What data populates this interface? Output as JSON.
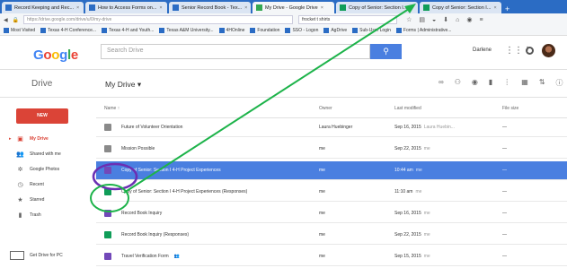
{
  "browser": {
    "tabs": [
      {
        "label": "Record Keeping and Rec...",
        "fav": "#2b6cc4",
        "active": false
      },
      {
        "label": "How to Access Forms on...",
        "fav": "#2b6cc4",
        "active": false
      },
      {
        "label": "Senior Record Book - Tex...",
        "fav": "#2b6cc4",
        "active": false
      },
      {
        "label": "My Drive - Google Drive",
        "fav": "#34a853",
        "active": true
      },
      {
        "label": "Copy of Senior: Section I...",
        "fav": "#0f9d58",
        "active": false
      },
      {
        "label": "Copy of Senior: Section I...",
        "fav": "#0f9d58",
        "active": false
      }
    ],
    "url": "https://drive.google.com/drive/u/0/my-drive",
    "search": "frocket t shirts",
    "bookmarks": [
      "Most Visited",
      "Texas 4-H Conference...",
      "Texas 4-H and Youth...",
      "Texas A&M University...",
      "4HOnline",
      "Foundation",
      "SSO - Logon",
      "AgDrive",
      "Sub-User Login",
      "Forms | Administrative..."
    ]
  },
  "header": {
    "logo": [
      "G",
      "o",
      "o",
      "g",
      "l",
      "e"
    ],
    "search_placeholder": "Search Drive",
    "search_button_icon": "search-icon",
    "user_name": "Darlene"
  },
  "toolbar": {
    "drive_label": "Drive",
    "location": "My Drive ▾",
    "icons": [
      "link-icon",
      "share-icon",
      "preview-icon",
      "delete-icon",
      "more-icon",
      "grid-view-icon",
      "sort-icon",
      "info-icon",
      "settings-icon"
    ]
  },
  "sidebar": {
    "new_label": "NEW",
    "items": [
      {
        "label": "My Drive",
        "icon": "▣",
        "active": true
      },
      {
        "label": "Shared with me",
        "icon": "👥",
        "active": false
      },
      {
        "label": "Google Photos",
        "icon": "✲",
        "active": false
      },
      {
        "label": "Recent",
        "icon": "◷",
        "active": false
      },
      {
        "label": "Starred",
        "icon": "★",
        "active": false
      },
      {
        "label": "Trash",
        "icon": "▮",
        "active": false
      }
    ],
    "get_drive": "Get Drive for PC"
  },
  "columns": {
    "name": "Name ↑",
    "owner": "Owner",
    "modified": "Last modified",
    "size": "File size"
  },
  "files": [
    {
      "name": "Future of Volunteer Orientation",
      "type": "folder",
      "owner": "Laura Huebinger",
      "modified": "Sep 16, 2015",
      "modified_by": "Laura Huebin...",
      "size": "—",
      "shared": false,
      "selected": false
    },
    {
      "name": "Mission Possible",
      "type": "folder",
      "owner": "me",
      "modified": "Sep 22, 2015",
      "modified_by": "me",
      "size": "—",
      "shared": false,
      "selected": false
    },
    {
      "name": "Copy of Senior: Section I 4-H Project Experiences",
      "type": "form",
      "owner": "me",
      "modified": "10:44 am",
      "modified_by": "me",
      "size": "—",
      "shared": false,
      "selected": true
    },
    {
      "name": "Copy of Senior: Section I 4-H Project Experiences (Responses)",
      "type": "sheet",
      "owner": "me",
      "modified": "11:10 am",
      "modified_by": "me",
      "size": "—",
      "shared": false,
      "selected": false
    },
    {
      "name": "Record Book Inquiry",
      "type": "form",
      "owner": "me",
      "modified": "Sep 16, 2015",
      "modified_by": "me",
      "size": "—",
      "shared": false,
      "selected": false
    },
    {
      "name": "Record Book Inquiry (Responses)",
      "type": "sheet",
      "owner": "me",
      "modified": "Sep 22, 2015",
      "modified_by": "me",
      "size": "—",
      "shared": false,
      "selected": false
    },
    {
      "name": "Travel Verification Form",
      "type": "form",
      "owner": "me",
      "modified": "Sep 15, 2015",
      "modified_by": "me",
      "size": "—",
      "shared": true,
      "selected": false
    }
  ],
  "annotation_colors": {
    "arrow": "#1db34a",
    "circle_purple": "#6b2fb3",
    "circle_green": "#1db34a"
  }
}
